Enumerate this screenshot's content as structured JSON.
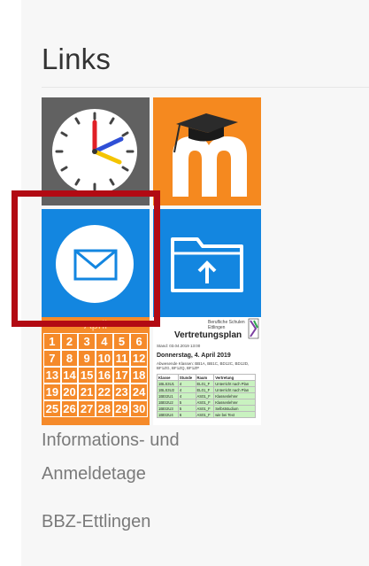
{
  "section": {
    "title": "Links"
  },
  "tiles": {
    "clock": {
      "icon": "clock-icon"
    },
    "moodle": {
      "icon": "moodle-icon"
    },
    "mail": {
      "icon": "mail-icon"
    },
    "folder": {
      "icon": "folder-upload-icon"
    },
    "calendar": {
      "icon": "calendar-icon",
      "month": "April",
      "days": [
        "1",
        "2",
        "3",
        "4",
        "5",
        "6",
        "7",
        "8",
        "9",
        "10",
        "11",
        "12",
        "13",
        "14",
        "15",
        "16",
        "17",
        "18",
        "19",
        "20",
        "21",
        "22",
        "23",
        "24",
        "25",
        "26",
        "27",
        "28",
        "29",
        "30"
      ]
    },
    "vertretungsplan": {
      "icon": "document-icon",
      "school": "Berufliche Schulen Ettlingen",
      "title": "Vertretungsplan",
      "stand": "Stand: 03.04.2019 13:00",
      "date_line": "Donnerstag, 4. April 2019",
      "sub": "Abwesende Klassen: BB1A, BB1C, BD12C, BD12D, BF1ZG, BF1ZQ, BF1ZP",
      "table_header": [
        "Klasse",
        "Stunde",
        "Raum",
        "Vertretung"
      ],
      "rows": [
        [
          "1BLS3U1",
          "4",
          "EL01_F",
          "Unterricht nach Plan"
        ],
        [
          "1BLS3U2",
          "4",
          "EL01_F",
          "Unterricht nach Plan"
        ],
        [
          "1BEI2U1",
          "4",
          "AS01_F",
          "Klassenlehrer"
        ],
        [
          "1BEI2U2",
          "5",
          "AS01_F",
          "Klassenlehrer"
        ],
        [
          "1BEI2U3",
          "5",
          "AS01_F",
          "Selbststudium"
        ],
        [
          "1BEI2U4",
          "6",
          "AS01_F",
          "wie bei Text"
        ]
      ]
    }
  },
  "links": [
    {
      "label": "Informations- und"
    },
    {
      "label": "Anmeldetage"
    },
    {
      "label": "BBZ-Ettlingen"
    }
  ],
  "colors": {
    "tile_blue": "#1386e0",
    "tile_orange": "#f5891f",
    "tile_gray": "#616161",
    "highlight_red": "#b20a13",
    "link_gray": "#7a7a7a"
  }
}
